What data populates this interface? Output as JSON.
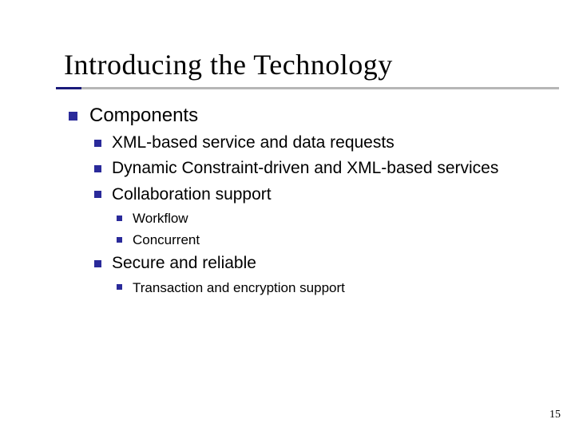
{
  "title": "Introducing the Technology",
  "page_number": "15",
  "bullets": {
    "l1_0": "Components",
    "l2_0": "XML-based service and data requests",
    "l2_1": "Dynamic Constraint-driven and XML-based services",
    "l2_2": "Collaboration support",
    "l3_0": "Workflow",
    "l3_1": "Concurrent",
    "l2_3": "Secure and reliable",
    "l3_2": "Transaction and encryption support"
  }
}
